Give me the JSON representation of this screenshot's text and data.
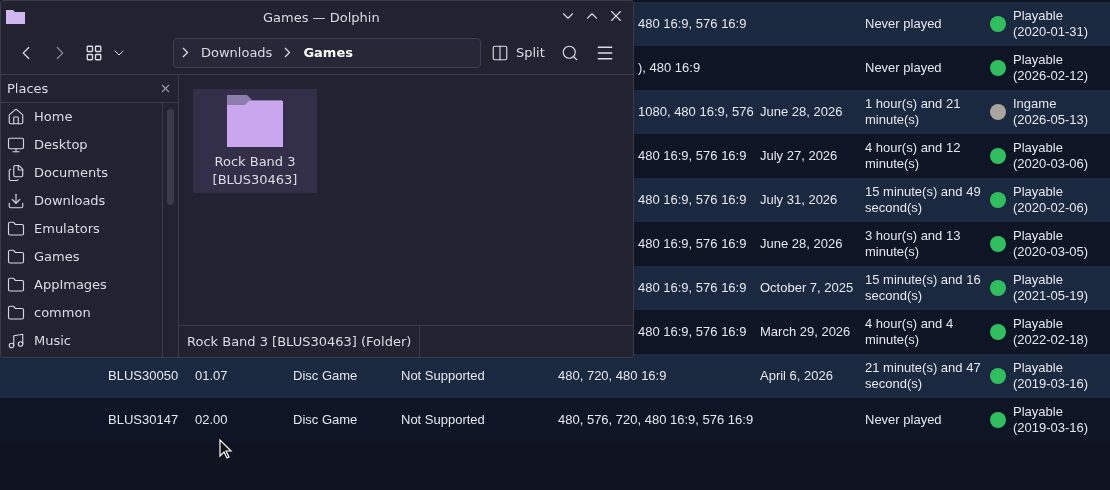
{
  "game_table": {
    "rows": [
      {
        "kind": "partial",
        "resolutions": "480 16:9, 576 16:9",
        "last_played": "",
        "time_played": "Never played",
        "compat": "Playable",
        "compat_date": "(2020-01-31)",
        "color": "#2fbf5f"
      },
      {
        "kind": "partial",
        "resolutions": "), 480 16:9",
        "last_played": "",
        "time_played": "Never played",
        "compat": "Playable",
        "compat_date": "(2026-02-12)",
        "color": "#2fbf5f"
      },
      {
        "kind": "partial",
        "resolutions": "1080, 480 16:9, 576",
        "last_played": "June 28, 2026",
        "time_played": "1 hour(s) and 21 minute(s)",
        "compat": "Ingame",
        "compat_date": "(2026-05-13)",
        "color": "#a9a49c"
      },
      {
        "kind": "partial",
        "resolutions": "480 16:9, 576 16:9",
        "last_played": "July 27, 2026",
        "time_played": "4 hour(s) and 12 minute(s)",
        "compat": "Playable",
        "compat_date": "(2020-03-06)",
        "color": "#2fbf5f"
      },
      {
        "kind": "partial",
        "resolutions": "480 16:9, 576 16:9",
        "last_played": "July 31, 2026",
        "time_played": "15 minute(s) and 49 second(s)",
        "compat": "Playable",
        "compat_date": "(2020-02-06)",
        "color": "#2fbf5f"
      },
      {
        "kind": "partial",
        "resolutions": "480 16:9, 576 16:9",
        "last_played": "June 28, 2026",
        "time_played": "3 hour(s) and 13 minute(s)",
        "compat": "Playable",
        "compat_date": "(2020-03-05)",
        "color": "#2fbf5f"
      },
      {
        "kind": "partial",
        "resolutions": "480 16:9, 576 16:9",
        "last_played": "October 7, 2025",
        "time_played": "15 minute(s) and 16 second(s)",
        "compat": "Playable",
        "compat_date": "(2021-05-19)",
        "color": "#2fbf5f"
      },
      {
        "kind": "partial",
        "resolutions": "480 16:9, 576 16:9",
        "last_played": "March 29, 2026",
        "time_played": "4 hour(s) and 4 minute(s)",
        "compat": "Playable",
        "compat_date": "(2022-02-18)",
        "color": "#2fbf5f"
      },
      {
        "kind": "full",
        "serial": "BLUS30050",
        "version": "01.07",
        "category": "Disc Game",
        "move": "Not Supported",
        "resolutions": "480, 720, 480 16:9",
        "last_played": "April 6, 2026",
        "time_played": "21 minute(s) and 47 second(s)",
        "compat": "Playable",
        "compat_date": "(2019-03-16)",
        "color": "#2fbf5f"
      },
      {
        "kind": "full",
        "serial": "BLUS30147",
        "version": "02.00",
        "category": "Disc Game",
        "move": "Not Supported",
        "resolutions": "480, 576, 720, 480 16:9, 576 16:9",
        "last_played": "",
        "time_played": "Never played",
        "compat": "Playable",
        "compat_date": "(2019-03-16)",
        "color": "#2fbf5f"
      }
    ]
  },
  "window": {
    "title": "Games — Dolphin",
    "breadcrumb": [
      {
        "label": "Downloads",
        "current": false
      },
      {
        "label": "Games",
        "current": true
      }
    ],
    "split_label": "Split",
    "places": {
      "title": "Places",
      "items": [
        {
          "label": "Home",
          "kind": "home"
        },
        {
          "label": "Desktop",
          "kind": "desktop"
        },
        {
          "label": "Documents",
          "kind": "documents"
        },
        {
          "label": "Downloads",
          "kind": "downloads"
        },
        {
          "label": "Emulators",
          "kind": "folder"
        },
        {
          "label": "Games",
          "kind": "folder"
        },
        {
          "label": "AppImages",
          "kind": "folder"
        },
        {
          "label": "common",
          "kind": "folder"
        },
        {
          "label": "Music",
          "kind": "music"
        }
      ]
    },
    "files": [
      {
        "name": "Rock Band 3 [BLUS30463]",
        "selected": true
      }
    ],
    "status": "Rock Band 3 [BLUS30463] (Folder)"
  }
}
